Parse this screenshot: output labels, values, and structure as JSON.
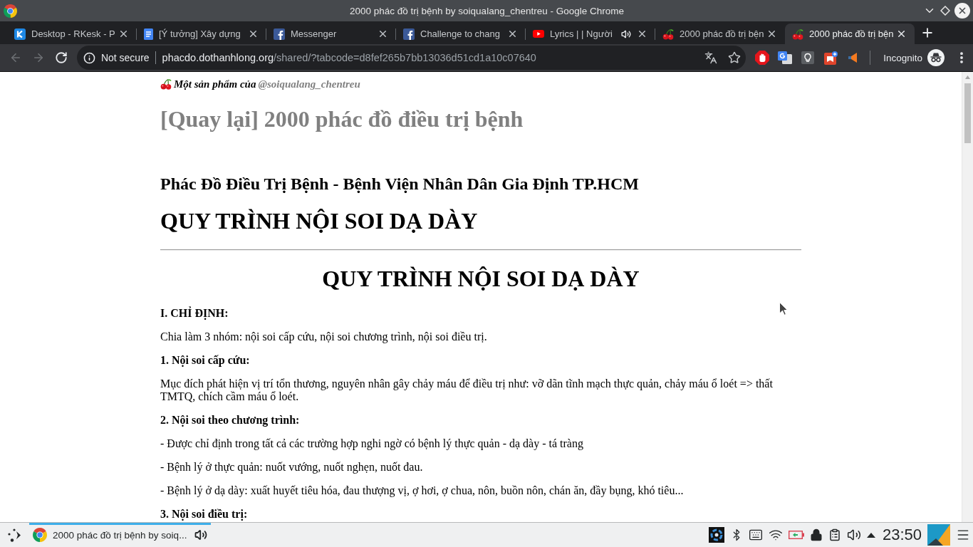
{
  "window": {
    "title": "2000 phác đồ trị bệnh by soiqualang_chentreu - Google Chrome"
  },
  "tabs": [
    {
      "kind": "letterk",
      "title": "Desktop - RKesk - P",
      "audio": false,
      "selected": false
    },
    {
      "kind": "document",
      "title": "[Ý tưởng] Xây dựng",
      "audio": false,
      "selected": false
    },
    {
      "kind": "letterf",
      "title": "Messenger",
      "audio": false,
      "selected": false
    },
    {
      "kind": "letterf",
      "title": "Challenge to chang",
      "audio": false,
      "selected": false
    },
    {
      "kind": "video",
      "title": "Lyrics | | Người",
      "audio": true,
      "selected": false
    },
    {
      "kind": "cherry",
      "title": "2000 phác đồ trị bện",
      "audio": false,
      "selected": false
    },
    {
      "kind": "cherry",
      "title": "2000 phác đồ trị bện",
      "audio": false,
      "selected": true
    }
  ],
  "toolbar": {
    "back_disabled": true,
    "forward_disabled": true,
    "security": "Not secure",
    "url_host": "phacdo.dothanhlong.org",
    "url_path": "/shared/?tabcode=d8fef265b7bb13036d51cd1a10c07640",
    "profile": "Incognito"
  },
  "page": {
    "byline": "Một sản phẩm của",
    "author": "@soiqualang_chentreu",
    "back_link": "[Quay lại] 2000 phác đồ điều trị bệnh",
    "source": "Phác Đồ Điều Trị Bệnh - Bệnh Viện Nhân Dân Gia Định TP.HCM",
    "heading": "QUY TRÌNH NỘI SOI DẠ DÀY",
    "document": {
      "title": "QUY TRÌNH NỘI SOI DẠ DÀY",
      "blocks": [
        {
          "kind": "heading",
          "text": "I. CHỈ ĐỊNH:"
        },
        {
          "kind": "paragraph",
          "text": "Chia làm 3 nhóm: nội soi cấp cứu, nội soi chương trình, nội soi điều trị."
        },
        {
          "kind": "heading",
          "text": "1. Nội soi cấp cứu:"
        },
        {
          "kind": "paragraph",
          "text": "Mục đích phát hiện vị trí tổn thương, nguyên nhân gây chảy máu để điều trị như: vỡ dãn tĩnh mạch thực quản, chảy máu ổ loét => thất TMTQ, chích cầm máu ổ loét."
        },
        {
          "kind": "heading",
          "text": "2. Nội soi theo chương trình:"
        },
        {
          "kind": "paragraph",
          "text": "- Được chỉ định trong tất cả các trường hợp nghi ngờ có bệnh lý thực quản - dạ dày - tá tràng"
        },
        {
          "kind": "paragraph",
          "text": "- Bệnh lý ở thực quản: nuốt vướng, nuốt nghẹn, nuốt đau."
        },
        {
          "kind": "paragraph",
          "text": "- Bệnh lý ở dạ dày: xuất huyết tiêu hóa, đau thượng vị, ợ hơi, ợ chua, nôn, buồn nôn, chán ăn, đầy bụng, khó tiêu..."
        },
        {
          "kind": "heading",
          "text": "3. Nội soi điều trị:"
        }
      ]
    }
  },
  "taskbar": {
    "task": {
      "title": "2000 phác đồ trị bệnh by soiq...",
      "audio": true
    },
    "clock": "23:50"
  }
}
